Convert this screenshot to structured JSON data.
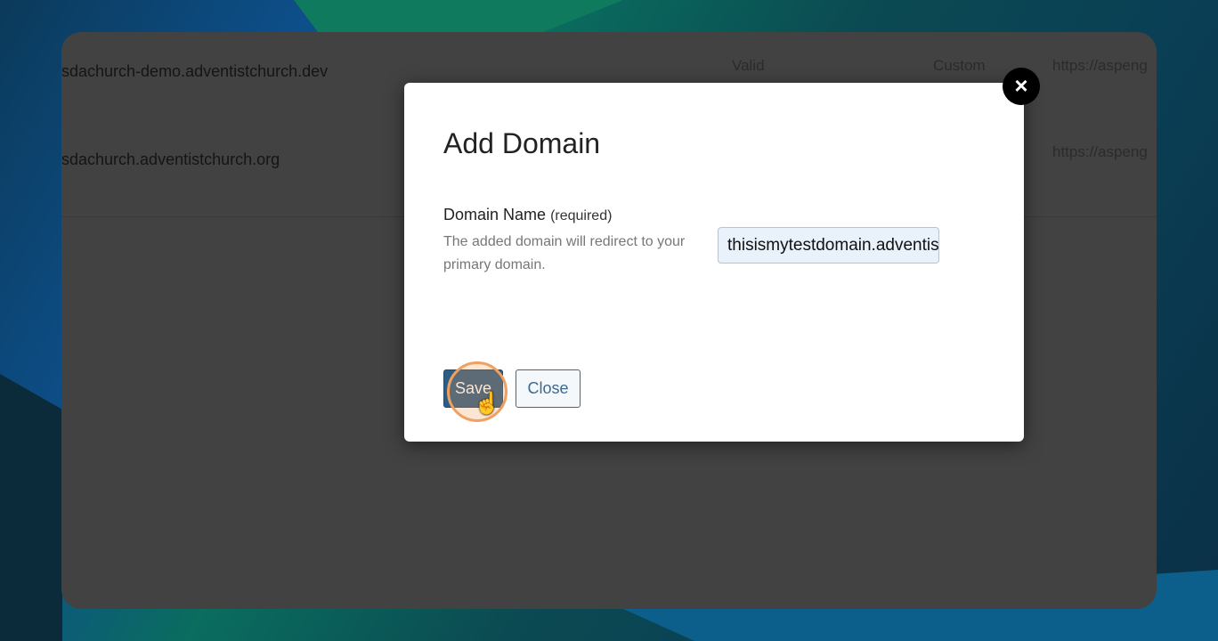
{
  "domains": [
    {
      "name": "sdachurch-demo.adventistchurch.dev",
      "status": "Valid",
      "type": "Custom",
      "url": "https://aspeng"
    },
    {
      "name": "sdachurch.adventistchurch.org",
      "status": "",
      "type": "",
      "url": "https://aspeng"
    }
  ],
  "modal": {
    "title": "Add Domain",
    "field_label": "Domain Name",
    "field_required": "(required)",
    "field_help": "The added domain will redirect to your primary domain.",
    "field_value": "thisismytestdomain.adventistchurch",
    "save_label": "Save",
    "close_label": "Close",
    "close_icon": "×"
  }
}
